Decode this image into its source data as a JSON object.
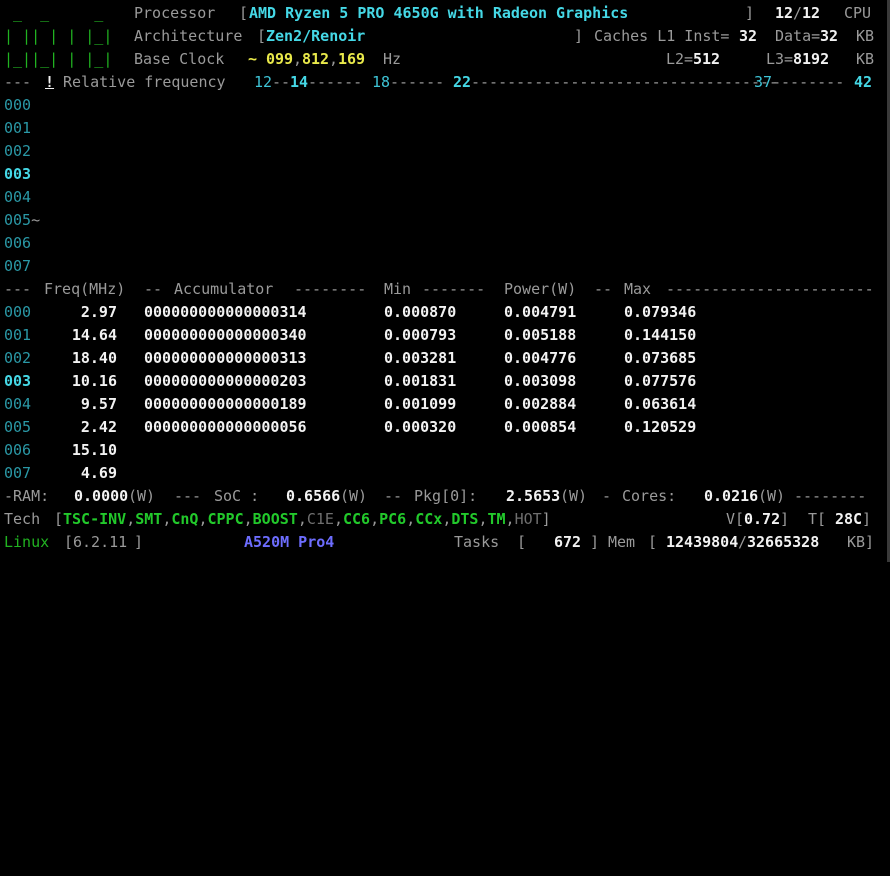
{
  "header": {
    "processor_label": "Processor",
    "processor_name": "AMD Ryzen 5 PRO 4650G with Radeon Graphics",
    "cpu_online": "12",
    "cpu_total": "12",
    "cpu_label": "CPU",
    "architecture_label": "Architecture",
    "architecture": "Zen2/Renoir",
    "caches_label": "Caches L1 Inst=",
    "l1_inst": "32",
    "l1_data_label": "Data=",
    "l1_data": "32",
    "kb_label": "KB",
    "base_clock_label": "Base Clock",
    "base_clock_a": "099",
    "base_clock_b": "812",
    "base_clock_c": "169",
    "hz_label": "Hz",
    "l2_label": "L2=",
    "l2": "512",
    "l3_label": "L3=",
    "l3": "8192",
    "logo": [
      " _  _     _",
      "| || | | |_|",
      "|_||_| | |_|"
    ]
  },
  "frequency_ruler": {
    "bang": "!",
    "label": "Relative frequency",
    "ticks": [
      "12",
      "14",
      "18",
      "22",
      "37",
      "42"
    ]
  },
  "core_ids": [
    "000",
    "001",
    "002",
    "003",
    "004",
    "005",
    "006",
    "007"
  ],
  "table": {
    "headers": [
      "Freq(MHz)",
      "Accumulator",
      "Min",
      "Power(W)",
      "Max"
    ],
    "rows": [
      {
        "id": "000",
        "freq": "2.97",
        "acc": "000000000000000314",
        "min": "0.000870",
        "power": "0.004791",
        "max": "0.079346"
      },
      {
        "id": "001",
        "freq": "14.64",
        "acc": "000000000000000340",
        "min": "0.000793",
        "power": "0.005188",
        "max": "0.144150"
      },
      {
        "id": "002",
        "freq": "18.40",
        "acc": "000000000000000313",
        "min": "0.003281",
        "power": "0.004776",
        "max": "0.073685"
      },
      {
        "id": "003",
        "freq": "10.16",
        "acc": "000000000000000203",
        "min": "0.001831",
        "power": "0.003098",
        "max": "0.077576"
      },
      {
        "id": "004",
        "freq": "9.57",
        "acc": "000000000000000189",
        "min": "0.001099",
        "power": "0.002884",
        "max": "0.063614"
      },
      {
        "id": "005",
        "freq": "2.42",
        "acc": "000000000000000056",
        "min": "0.000320",
        "power": "0.000854",
        "max": "0.120529"
      },
      {
        "id": "006",
        "freq": "15.10"
      },
      {
        "id": "007",
        "freq": "4.69"
      }
    ]
  },
  "power": {
    "ram_label": "-RAM:",
    "ram": "0.0000",
    "soc_label": "SoC :",
    "soc": "0.6566",
    "pkg_label": "Pkg[0]:",
    "pkg": "2.5653",
    "cores_label": "Cores:",
    "cores": "0.0216",
    "unit": "(W)"
  },
  "tech": {
    "label": "Tech",
    "items": [
      {
        "name": "TSC-INV",
        "active": true
      },
      {
        "name": "SMT",
        "active": true
      },
      {
        "name": "CnQ",
        "active": true
      },
      {
        "name": "CPPC",
        "active": true
      },
      {
        "name": "BOOST",
        "active": true
      },
      {
        "name": "C1E",
        "active": false
      },
      {
        "name": "CC6",
        "active": true
      },
      {
        "name": "PC6",
        "active": true
      },
      {
        "name": "CCx",
        "active": true
      },
      {
        "name": "DTS",
        "active": true
      },
      {
        "name": "TM",
        "active": true
      },
      {
        "name": "HOT",
        "active": false
      }
    ],
    "v_label": "V",
    "voltage": "0.72",
    "t_label": "T",
    "temp": "28",
    "temp_unit": "C"
  },
  "status": {
    "os": "Linux",
    "kernel": "6.2.11",
    "board": "A520M Pro4",
    "tasks_label": "Tasks",
    "tasks": "672",
    "mem_label": "Mem",
    "mem_used": "12439804",
    "mem_total": "32665328",
    "mem_unit": "KB"
  },
  "colors": {
    "background": "#000000",
    "cyan": "#3ec4d6",
    "yellow": "#e9e94a",
    "green": "#22c92b",
    "blue": "#6d6dff"
  }
}
